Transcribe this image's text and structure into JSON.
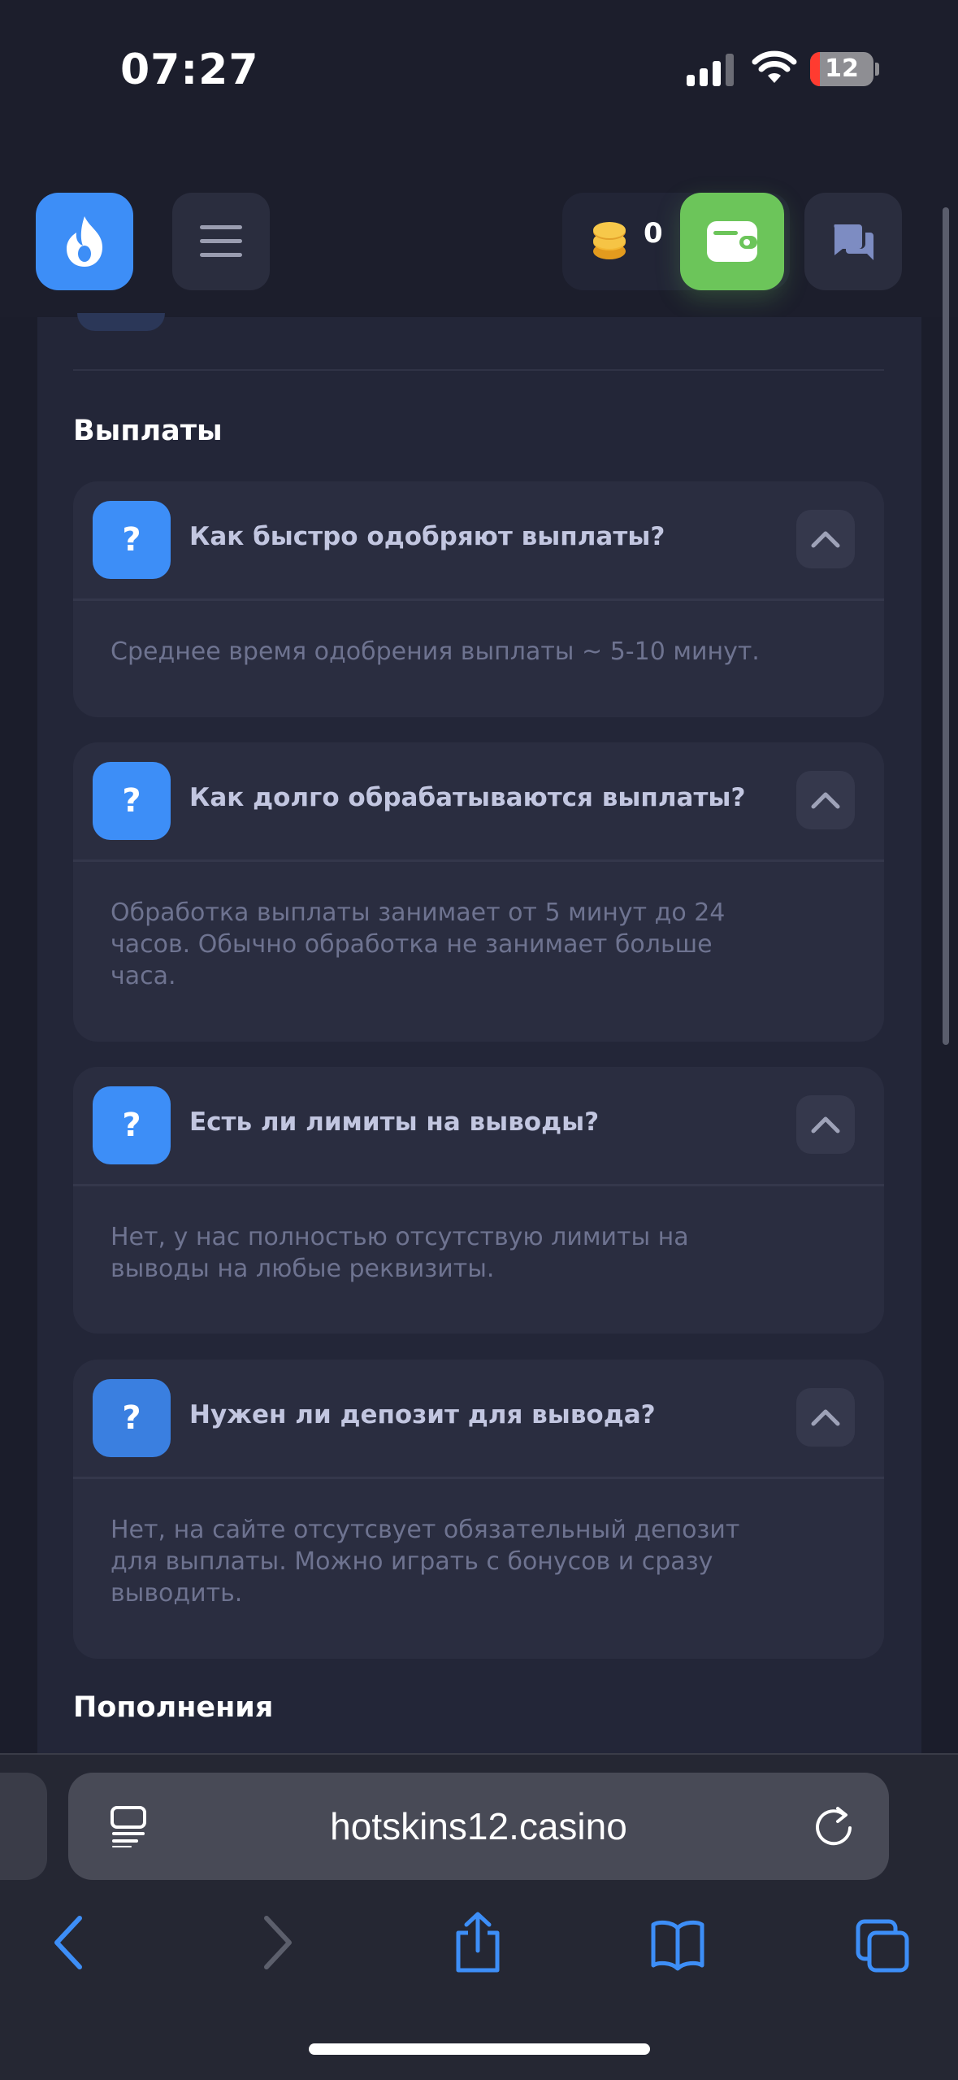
{
  "status_bar": {
    "time": "07:27",
    "battery": "12"
  },
  "header": {
    "logo_icon": "flame-icon",
    "menu_icon": "hamburger-icon",
    "coin_icon": "coins-icon",
    "balance": "0",
    "wallet_icon": "wallet-icon",
    "chat_icon": "chat-icon",
    "colors": {
      "brand_blue": "#3d8ef7",
      "wallet_green": "#6cc55a"
    }
  },
  "sections": {
    "payouts_title": "Выплаты",
    "deposits_title": "Пополнения"
  },
  "faq": [
    {
      "question": "Как быстро одобряют выплаты?",
      "answer": "Среднее время одобрения выплаты ~ 5-10 минут."
    },
    {
      "question": "Как долго обрабатываются выплаты?",
      "answer": "Обработка выплаты занимает от 5 минут до 24 часов. Обычно обработка не занимает больше часа."
    },
    {
      "question": "Есть ли лимиты на выводы?",
      "answer": "Нет, у нас полностью отсутствую лимиты на выводы на любые реквизиты."
    },
    {
      "question": "Нужен ли депозит для вывода?",
      "answer": "Нет, на сайте отсутсвует обязательный депозит для выплаты. Можно играть с бонусов и сразу выводить."
    }
  ],
  "browser": {
    "url": "hotskins12.casino",
    "icons": [
      "reader-icon",
      "reload-icon",
      "back-icon",
      "forward-icon",
      "share-icon",
      "bookmarks-icon",
      "tabs-icon"
    ]
  }
}
